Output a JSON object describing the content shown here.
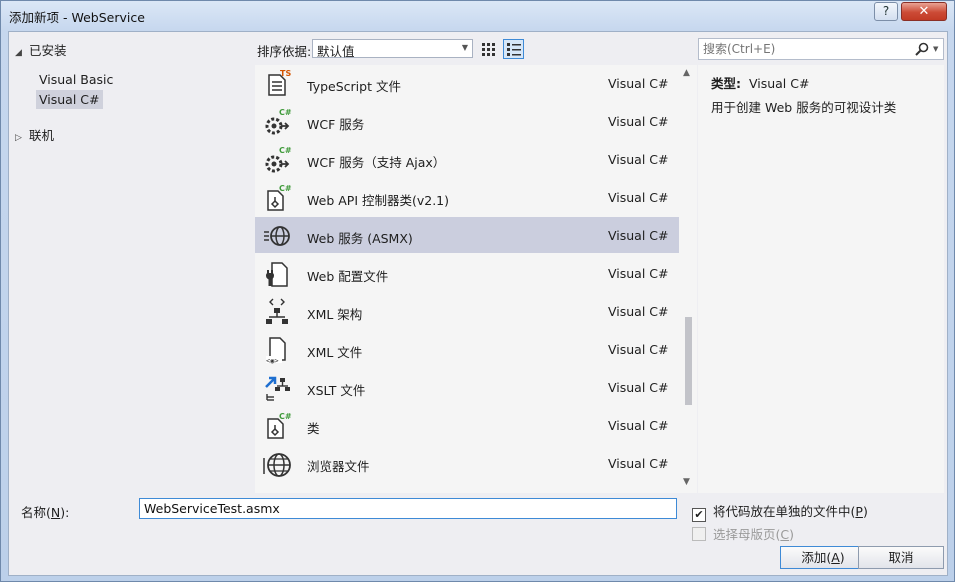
{
  "window": {
    "title": "添加新项 - WebService",
    "help_glyph": "?",
    "close_glyph": "✕"
  },
  "tree": {
    "installed": "已安装",
    "children": [
      "Visual Basic",
      "Visual C#"
    ],
    "selected": "Visual C#",
    "online": "联机"
  },
  "toolbar": {
    "sort_label": "排序依据:",
    "sort_value": "默认值",
    "view_grid_icon": "grid-view-icon",
    "view_list_icon": "list-view-icon"
  },
  "items": [
    {
      "name": "TypeScript 文件",
      "lang": "Visual C#",
      "icon": "typescript-file-icon"
    },
    {
      "name": "WCF 服务",
      "lang": "Visual C#",
      "icon": "wcf-service-icon"
    },
    {
      "name": "WCF 服务（支持 Ajax）",
      "lang": "Visual C#",
      "icon": "wcf-ajax-service-icon"
    },
    {
      "name": "Web API 控制器类(v2.1)",
      "lang": "Visual C#",
      "icon": "web-api-controller-icon"
    },
    {
      "name": "Web 服务 (ASMX)",
      "lang": "Visual C#",
      "icon": "web-service-icon",
      "selected": true
    },
    {
      "name": "Web 配置文件",
      "lang": "Visual C#",
      "icon": "web-config-icon"
    },
    {
      "name": "XML 架构",
      "lang": "Visual C#",
      "icon": "xml-schema-icon"
    },
    {
      "name": "XML 文件",
      "lang": "Visual C#",
      "icon": "xml-file-icon"
    },
    {
      "name": "XSLT 文件",
      "lang": "Visual C#",
      "icon": "xslt-file-icon"
    },
    {
      "name": "类",
      "lang": "Visual C#",
      "icon": "class-icon"
    },
    {
      "name": "浏览器文件",
      "lang": "Visual C#",
      "icon": "browser-file-icon"
    }
  ],
  "search": {
    "placeholder": "搜索(Ctrl+E)"
  },
  "details": {
    "type_label": "类型:",
    "type_value": "Visual C#",
    "description": "用于创建 Web 服务的可视设计类"
  },
  "bottom": {
    "name_label_prefix": "名称(",
    "name_label_key": "N",
    "name_label_suffix": "):",
    "name_value": "WebServiceTest.asmx",
    "separate_file_prefix": "将代码放在单独的文件中(",
    "separate_file_key": "P",
    "separate_file_suffix": ")",
    "separate_file_checked": true,
    "master_page_prefix": "选择母版页(",
    "master_page_key": "C",
    "master_page_suffix": ")",
    "master_page_checked": false,
    "add_prefix": "添加(",
    "add_key": "A",
    "add_suffix": ")",
    "cancel_label": "取消"
  },
  "colors": {
    "selection": "#cbcede",
    "csharp_green": "#3f9a3a",
    "ts_orange": "#d35400",
    "focus_blue": "#3e8ad6"
  }
}
